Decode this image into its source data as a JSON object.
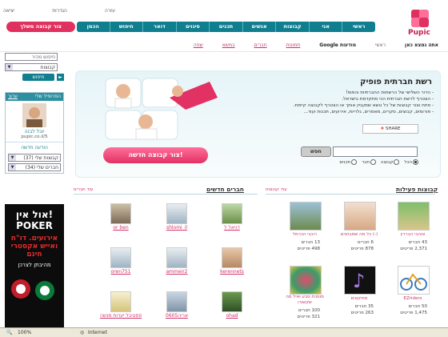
{
  "top_links": [
    "עזרה",
    "הגדרות",
    "יציאה"
  ],
  "logo": {
    "text": "Pupic"
  },
  "nav": {
    "items": [
      "ראשי",
      "אני",
      "קבוצות",
      "אנשים",
      "תכנים",
      "סיגוים",
      "דואר",
      "חיפוש מתקדם",
      "הכמן"
    ],
    "create_group": "צור קבוצה משלך"
  },
  "subnav": {
    "items": [
      "אתה נמצא כאן",
      "ראשי",
      "מודעות Google",
      "תמונות",
      "חברים",
      "במשא",
      "שפה"
    ]
  },
  "sidebar": {
    "search_placeholder": "חיפוש מהיר",
    "select_value": "קבוצות",
    "search_button": "חיפוש",
    "profile_title": "הפרופיל שלי",
    "profile_edit": "ערוך",
    "profile_name": "יובל לבנה",
    "profile_site": "pupic.co.il/5",
    "inbox_label": "הודעה חדשה",
    "my_groups": "קבוצות שלי (37)",
    "my_friends": "חברים שלי (34)"
  },
  "hero": {
    "title": "רשת חברתית פופיק",
    "bullets": [
      "- הדור השלישי של הרשתות החברתיות והפופ!",
      "- הצטרף לרשת חברתית הכי מתקדמת בישראל.",
      "- פתח וצור קבוצות של כל נושא שמעניין אותך או הצטרף לקבוצה קיימת.",
      "- פורומים, קבוצים, סקרים, מאמרים, גלריות, אירועים, תכנות ועוד..."
    ],
    "share_label": "SHARE",
    "cta": "צור קבוצה חדשה!",
    "search_button": "חפש",
    "radio_options": [
      "הכל",
      "קבוצה",
      "חבר",
      "תכנים"
    ]
  },
  "groups_section": {
    "title": "קבוצות פעילות",
    "all_link": "עוד קבוצות",
    "items": [
      {
        "name": "אוהבי הבררין",
        "members": "43 חברים",
        "posts": "2,371 פריטים"
      },
      {
        "name": "כל מה שמבחנים (-)",
        "members": "6 חברים",
        "posts": "878 פריטים"
      },
      {
        "name": "רוכבי הכרמל",
        "members": "13 חברים",
        "posts": "498 פריטים"
      },
      {
        "name": "EZriders",
        "members": "50 חברים",
        "posts": "1,475 פריטים"
      },
      {
        "name": "מוזיקאים",
        "members": "35 חברים",
        "posts": "263 פריטים"
      },
      {
        "name": "מוסכת סבע ואיל מה שקשורו",
        "members": "100 חברים",
        "posts": "321 פריטים"
      }
    ]
  },
  "friends_section": {
    "title": "חברים חדשים",
    "all_link": "עוד חברים",
    "items": [
      "דניאל ל",
      "shlomi_il",
      "or ben",
      "kerennets",
      "ammeir2",
      "oren751",
      "ohad",
      "אריה0605",
      "פסטיבל יערות מנשה"
    ]
  },
  "browser": {
    "zone": "Internet",
    "zoom": "100%"
  },
  "ad": {
    "line1": "אול אין!",
    "line2": "POKER",
    "line3": "אירועים. דו\"ח",
    "line4": "ואייש אקסטרי",
    "line5": "חינם",
    "line6": "מהיבתן לצרכן"
  },
  "colors": {
    "teal": "#0f7e8f",
    "pink": "#e0305f"
  }
}
